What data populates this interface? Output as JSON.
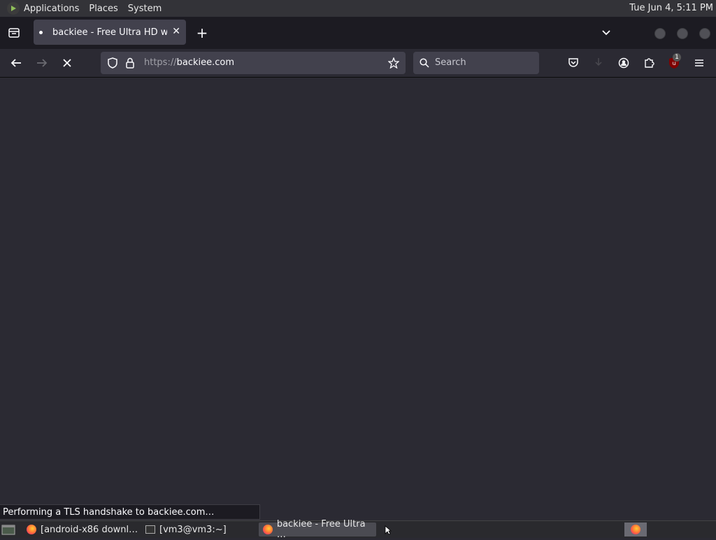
{
  "topbar": {
    "menus": [
      "Applications",
      "Places",
      "System"
    ],
    "clock": "Tue Jun  4, 5:11 PM"
  },
  "tab": {
    "title": "backiee - Free Ultra HD wall"
  },
  "navbar": {
    "url_scheme": "https://",
    "url_host": "backiee.com",
    "search_placeholder": "Search",
    "extension_badge": "1"
  },
  "status": {
    "text": "Performing a TLS handshake to backiee.com…"
  },
  "taskbar": {
    "items": [
      "[android-x86 downl…",
      "[vm3@vm3:~]",
      "backiee - Free Ultra …"
    ]
  },
  "colors": {
    "content_bg": "#2b2a33",
    "tabstrip_bg": "#1c1b22",
    "ublock_red": "#800000"
  }
}
